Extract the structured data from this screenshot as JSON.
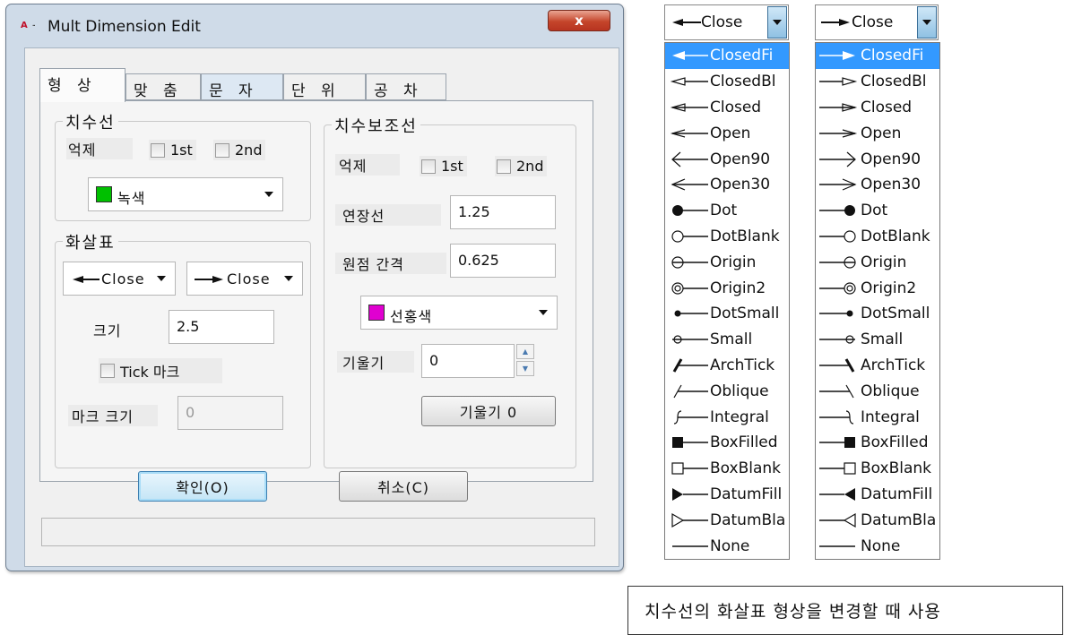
{
  "dialog": {
    "app_icon_text": "A",
    "title": "Mult Dimension Edit",
    "close_label": "x",
    "tabs": [
      {
        "label": "형 상",
        "active": true
      },
      {
        "label": "맞 춤"
      },
      {
        "label": "문 자"
      },
      {
        "label": "단 위"
      },
      {
        "label": "공 차"
      }
    ],
    "dim_line": {
      "title": "치수선",
      "suppress_label": "억제",
      "check_1st": "1st",
      "check_2nd": "2nd",
      "color_label": "녹색",
      "color_value": "#00c000"
    },
    "arrows": {
      "title": "화살표",
      "first": "Close",
      "second": "Close",
      "size_label": "크기",
      "size_value": "2.5",
      "tick_label": "Tick 마크",
      "mark_size_label": "마크 크기",
      "mark_size_value": "0"
    },
    "ext_line": {
      "title": "치수보조선",
      "suppress_label": "억제",
      "check_1st": "1st",
      "check_2nd": "2nd",
      "extend_label": "연장선",
      "extend_value": "1.25",
      "offset_label": "원점 간격",
      "offset_value": "0.625",
      "color_label": "선홍색",
      "color_value": "#e000d0",
      "oblique_label": "기울기",
      "oblique_value": "0",
      "oblique_button": "기울기 0"
    },
    "ok_button": "확인(O)",
    "cancel_button": "취소(C)"
  },
  "arrow_lists": [
    {
      "head": "Close",
      "items": [
        "ClosedFi",
        "ClosedBl",
        "Closed",
        "Open",
        "Open90",
        "Open30",
        "Dot",
        "DotBlank",
        "Origin",
        "Origin2",
        "DotSmall",
        "Small",
        "ArchTick",
        "Oblique",
        "Integral",
        "BoxFilled",
        "BoxBlank",
        "DatumFill",
        "DatumBla",
        "None"
      ]
    },
    {
      "head": "Close",
      "items": [
        "ClosedFi",
        "ClosedBl",
        "Closed",
        "Open",
        "Open90",
        "Open30",
        "Dot",
        "DotBlank",
        "Origin",
        "Origin2",
        "DotSmall",
        "Small",
        "ArchTick",
        "Oblique",
        "Integral",
        "BoxFilled",
        "BoxBlank",
        "DatumFill",
        "DatumBla",
        "None"
      ]
    }
  ],
  "selected_item": "ClosedFi",
  "caption": "치수선의 화살표 형상을 변경할 때 사용"
}
